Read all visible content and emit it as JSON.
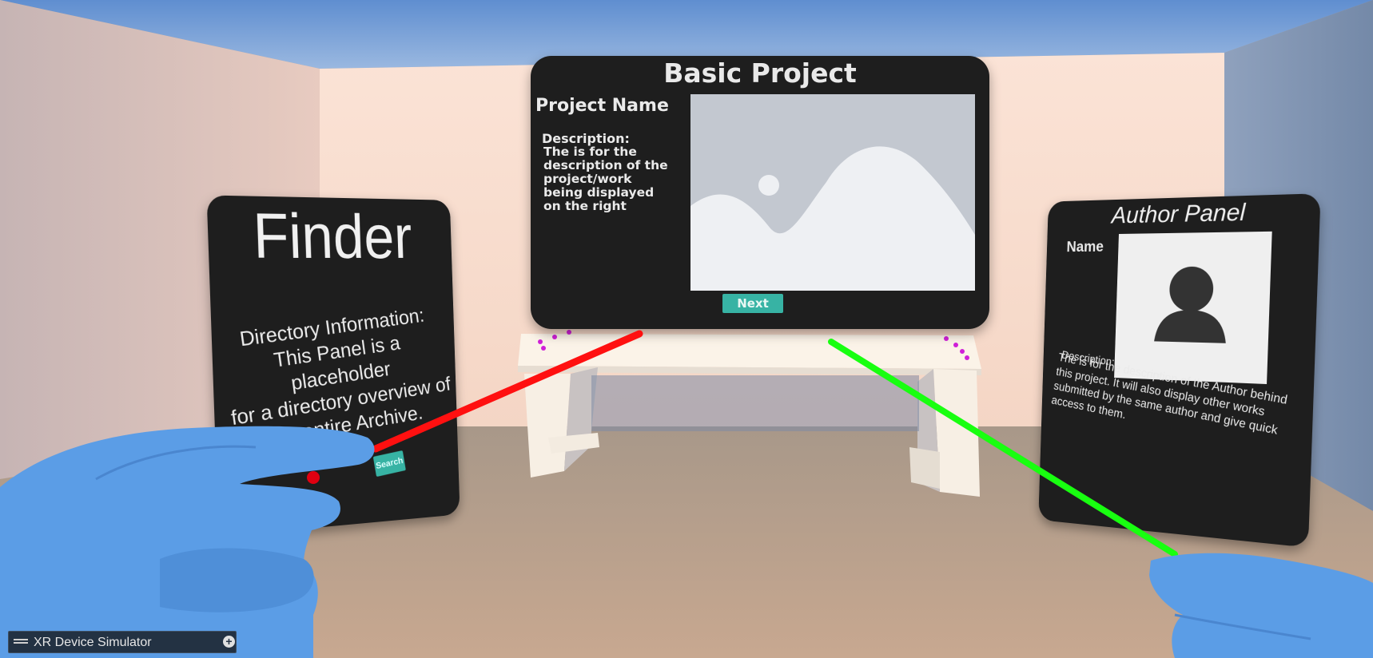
{
  "basic_panel": {
    "title": "Basic Project",
    "project_name": "Project Name",
    "description_heading": "Description:",
    "description_lines": [
      "The is for the",
      "description of the",
      "project/work",
      "being displayed",
      "on the right"
    ],
    "next_label": "Next",
    "image_icon": "image-placeholder-icon"
  },
  "finder_panel": {
    "title": "Finder",
    "info_lines": [
      "Directory Information:",
      "This Panel is a placeholder",
      "for a directory overview of",
      "the entire Archive."
    ],
    "search_label": "Search"
  },
  "author_panel": {
    "title": "Author Panel",
    "name_label": "Name",
    "avatar_icon": "user-avatar-icon",
    "description_heading": "Description:",
    "description_lines": [
      "The is for the description of the Author behind",
      "this project. It will also display other works",
      "submitted by the same author and give quick",
      "access to them."
    ]
  },
  "simulator_bar": {
    "label": "XR Device Simulator",
    "handle_icon": "drag-handle-icon",
    "expand_icon": "expand-plus-icon"
  },
  "colors": {
    "panel": "#1e1e1e",
    "button": "#37b3a4",
    "left_ray": "#ff1010",
    "right_ray": "#10ff10",
    "hand": "#5b9de6"
  }
}
